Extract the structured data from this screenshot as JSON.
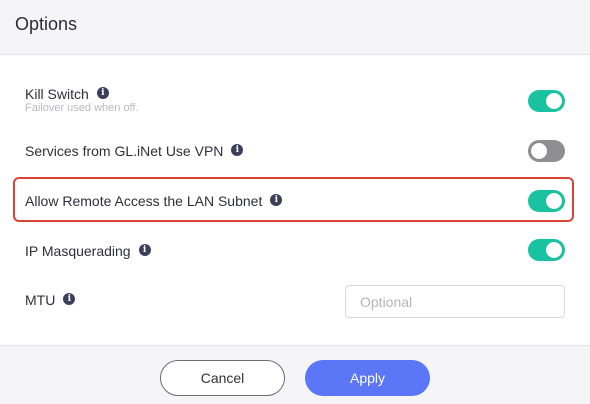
{
  "dialog": {
    "title": "Options"
  },
  "options": {
    "kill_switch": {
      "label": "Kill Switch",
      "hint": "Failover used when off.",
      "enabled": true
    },
    "glinet_services": {
      "label": "Services from GL.iNet Use VPN",
      "enabled": false
    },
    "remote_access": {
      "label": "Allow Remote Access the LAN Subnet",
      "enabled": true
    },
    "ip_masquerading": {
      "label": "IP Masquerading",
      "enabled": true
    },
    "mtu": {
      "label": "MTU",
      "placeholder": "Optional",
      "value": ""
    }
  },
  "info_icon_glyph": "i",
  "footer": {
    "cancel_label": "Cancel",
    "apply_label": "Apply"
  },
  "colors": {
    "toggle_on": "#19c3a2",
    "toggle_off": "#8e8e93",
    "apply_button": "#5b76f6",
    "highlight_border": "#d94436"
  }
}
